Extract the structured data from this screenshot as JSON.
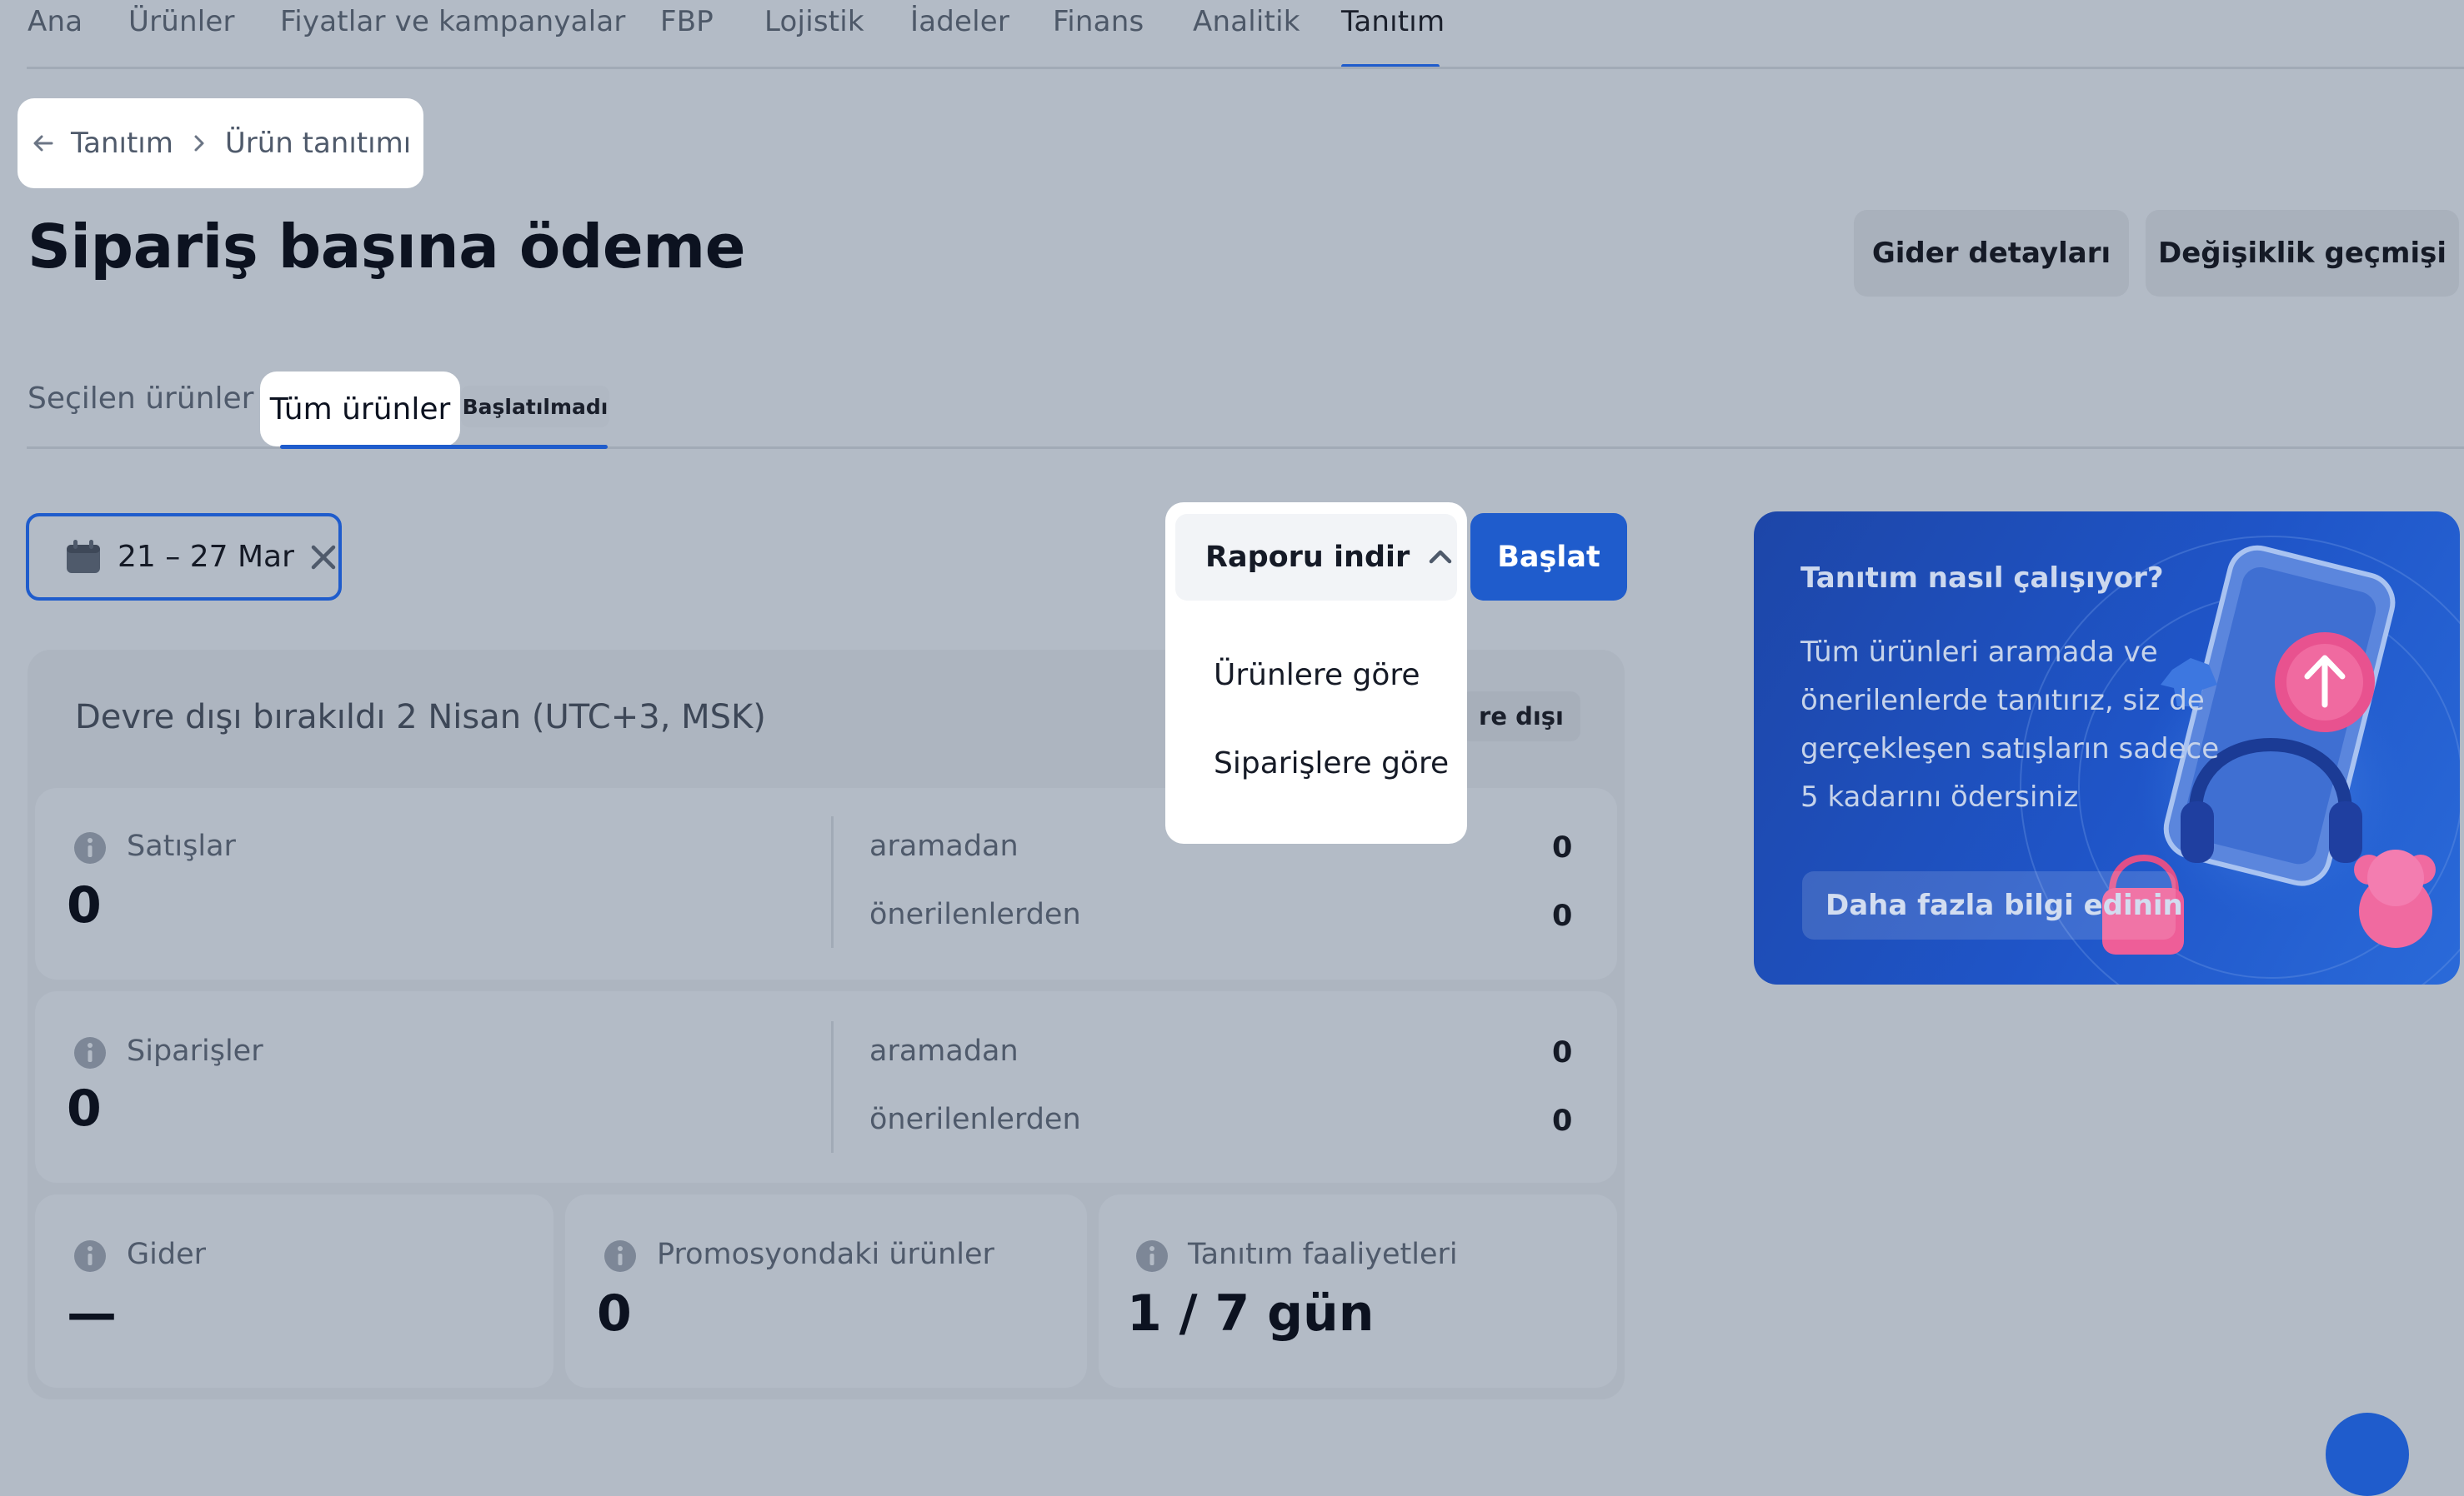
{
  "nav": {
    "items": [
      "Ana",
      "Ürünler",
      "Fiyatlar ve kampanyalar",
      "FBP",
      "Lojistik",
      "İadeler",
      "Finans",
      "Analitik",
      "Tanıtım"
    ],
    "active_index": 8
  },
  "breadcrumb": {
    "parent": "Tanıtım",
    "current": "Ürün tanıtımı"
  },
  "page": {
    "title": "Sipariş başına ödeme"
  },
  "header_buttons": {
    "expense_details": "Gider detayları",
    "change_history": "Değişiklik geçmişi"
  },
  "tabs": {
    "selected_products": "Seçilen ürünler",
    "all_products": "Tüm ürünler",
    "all_products_badge": "Başlatılmadı"
  },
  "date_filter": {
    "value": "21 – 27 Mar"
  },
  "report": {
    "trigger_label": "Raporu indir",
    "options": [
      "Ürünlere göre",
      "Siparişlere göre"
    ]
  },
  "start_button": {
    "label": "Başlat"
  },
  "status": {
    "title": "Devre dışı bırakıldı 2 Nisan (UTC+3, MSK)",
    "badge_visible": "re dışı"
  },
  "metrics": {
    "sales": {
      "label": "Satışlar",
      "value": "0",
      "from_search_label": "aramadan",
      "from_search_value": "0",
      "from_recommended_label": "önerilenlerden",
      "from_recommended_value": "0"
    },
    "orders": {
      "label": "Siparişler",
      "value": "0",
      "from_search_label": "aramadan",
      "from_search_value": "0",
      "from_recommended_label": "önerilenlerden",
      "from_recommended_value": "0"
    },
    "expense": {
      "label": "Gider",
      "value": "—"
    },
    "promo_products": {
      "label": "Promosyondaki ürünler",
      "value": "0"
    },
    "promo_activity": {
      "label": "Tanıtım faaliyetleri",
      "value": "1 / 7 gün"
    }
  },
  "promo_card": {
    "title": "Tanıtım nasıl çalışıyor?",
    "body": "Tüm ürünleri aramada ve önerilenlerde tanıtırız, siz de gerçekleşen satışların sadece 5 kadarını ödersiniz",
    "button": "Daha fazla bilgi edinin"
  },
  "colors": {
    "accent": "#1f5ccc",
    "overlay_background": "#b3bbc6",
    "panel": "#ffffff"
  },
  "icons": [
    "back-arrow-icon",
    "chevron-right-icon",
    "calendar-icon",
    "close-icon",
    "chevron-up-icon",
    "info-icon"
  ]
}
